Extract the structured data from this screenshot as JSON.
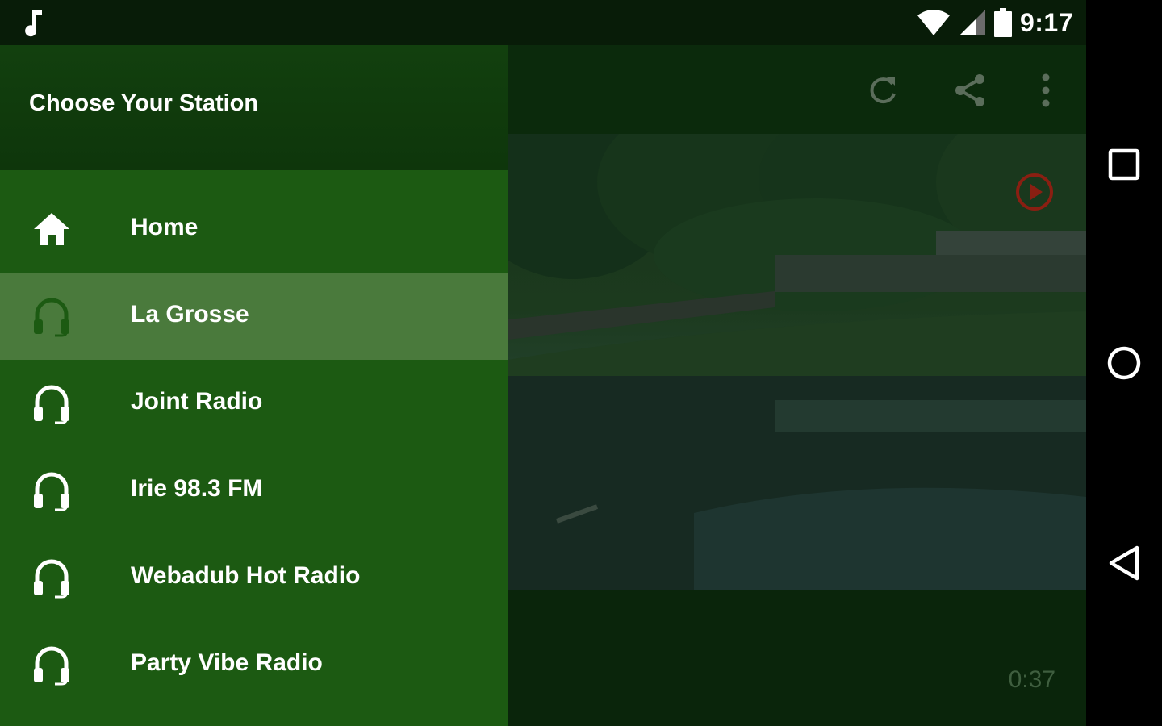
{
  "status_bar": {
    "time": "9:17",
    "left_icon": "music-note-icon",
    "right_icons": [
      "wifi-icon",
      "cell-signal-icon",
      "battery-icon"
    ]
  },
  "drawer": {
    "title": "Choose Your Station",
    "items": [
      {
        "label": "Home",
        "icon": "home-icon",
        "selected": false
      },
      {
        "label": "La Grosse",
        "icon": "headphones-icon",
        "selected": true
      },
      {
        "label": "Joint Radio",
        "icon": "headphones-icon",
        "selected": false
      },
      {
        "label": "Irie 98.3 FM",
        "icon": "headphones-icon",
        "selected": false
      },
      {
        "label": "Webadub Hot Radio",
        "icon": "headphones-icon",
        "selected": false
      },
      {
        "label": "Party Vibe Radio",
        "icon": "headphones-icon",
        "selected": false
      }
    ]
  },
  "toolbar": {
    "icons": [
      "refresh-icon",
      "share-icon",
      "more-vert-icon"
    ]
  },
  "player": {
    "elapsed": "0:37"
  },
  "system_nav": {
    "buttons": [
      "recents-button",
      "home-button",
      "back-button"
    ]
  },
  "colors": {
    "drawer_bg": "#1c5a12",
    "drawer_header_bg": "#0f380c",
    "selected_item_bg": "#4a7a3c",
    "selected_icon": "#1c5a12",
    "play_overlay_accent": "#8a1f12"
  }
}
